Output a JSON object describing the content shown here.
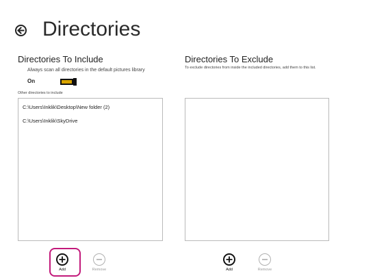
{
  "header": {
    "title": "Directories"
  },
  "include": {
    "title": "Directories To Include",
    "scan_text": "Always scan all directories in the default pictures library",
    "toggle_state": "On",
    "toggle_on": true,
    "other_label": "Other directories to include",
    "directories": [
      "C:\\Users\\Inklik\\Desktop\\New folder (2)",
      "C:\\Users\\Inklik\\SkyDrive"
    ],
    "add_label": "Add",
    "remove_label": "Remove"
  },
  "exclude": {
    "title": "Directories To Exclude",
    "description": "To exclude directories from inside the included directories, add them to this list.",
    "directories": [],
    "add_label": "Add",
    "remove_label": "Remove"
  },
  "colors": {
    "accent_toggle": "#d9a400",
    "highlight": "#c2187a"
  }
}
